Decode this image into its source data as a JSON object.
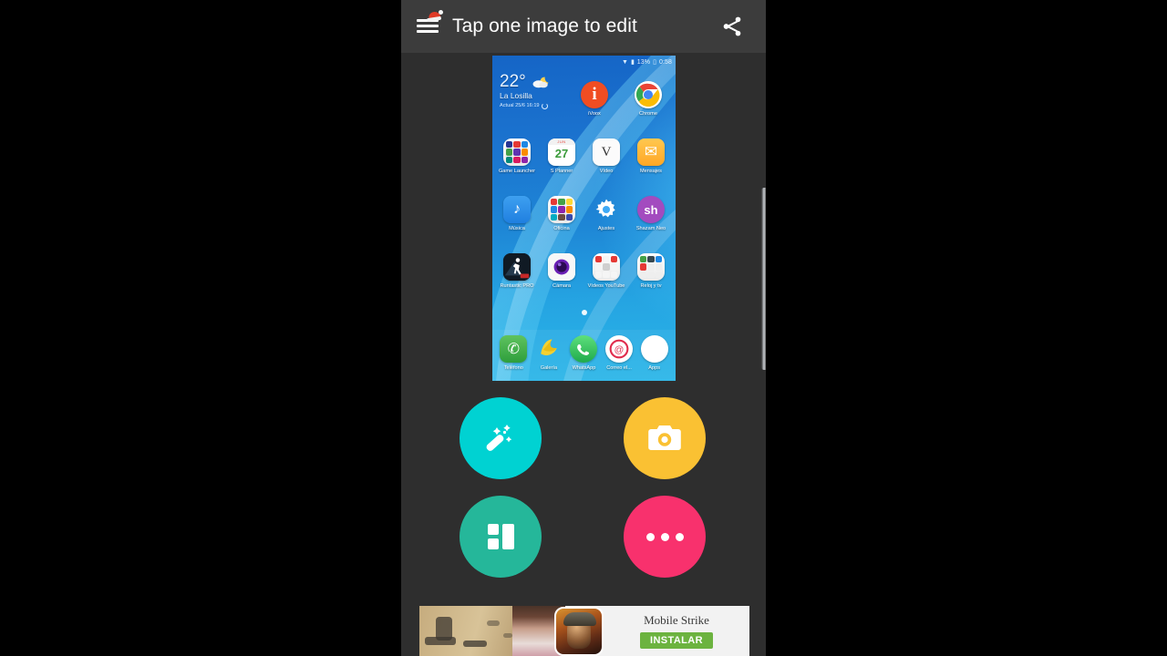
{
  "appbar": {
    "title": "Tap one image to edit",
    "menu_icon": "hamburger-menu-icon-with-santa-hat",
    "share_icon": "share-icon"
  },
  "screenshot": {
    "status_bar": {
      "wifi_icon": "wifi-icon",
      "signal_icon": "signal-icon",
      "battery_percent": "13%",
      "battery_icon": "battery-icon",
      "time": "0:58"
    },
    "weather": {
      "temperature": "22°",
      "icon": "partly-cloudy-night-icon",
      "city": "La Losilla",
      "updated": "Actual 25/6 16:19"
    },
    "rows": [
      {
        "apps": [
          {
            "label": "iVoox",
            "icon": "ivoox-icon",
            "glyph": "i"
          },
          {
            "label": "Chrome",
            "icon": "chrome-icon",
            "glyph": ""
          }
        ]
      },
      {
        "apps": [
          {
            "label": "Game Launcher",
            "icon": "game-launcher-folder-icon",
            "glyph": ""
          },
          {
            "label": "S Planner",
            "icon": "s-planner-icon",
            "glyph": "27",
            "month": "JUN"
          },
          {
            "label": "Vídeo",
            "icon": "v-app-icon",
            "glyph": "V"
          },
          {
            "label": "Mensajes",
            "icon": "messages-icon",
            "glyph": "✉"
          }
        ]
      },
      {
        "apps": [
          {
            "label": "Música",
            "icon": "music-icon",
            "glyph": "♪"
          },
          {
            "label": "Oficina",
            "icon": "office-folder-icon",
            "glyph": ""
          },
          {
            "label": "Ajustes",
            "icon": "settings-gear-icon",
            "glyph": ""
          },
          {
            "label": "Shazam Neo",
            "icon": "shazam-icon",
            "glyph": "sh"
          }
        ]
      },
      {
        "apps": [
          {
            "label": "Runtastic PRO",
            "icon": "runtastic-icon",
            "glyph": ""
          },
          {
            "label": "Cámara",
            "icon": "camera-app-icon",
            "glyph": ""
          },
          {
            "label": "Vídeos YouTube",
            "icon": "youtube-folder-icon",
            "glyph": ""
          },
          {
            "label": "Reloj y tv",
            "icon": "clock-tv-folder-icon",
            "glyph": ""
          }
        ]
      }
    ],
    "dock": [
      {
        "label": "Teléfono",
        "icon": "phone-icon",
        "glyph": "✆"
      },
      {
        "label": "Galería",
        "icon": "gallery-icon",
        "glyph": ""
      },
      {
        "label": "WhatsApp",
        "icon": "whatsapp-icon",
        "glyph": ""
      },
      {
        "label": "Correo el...",
        "icon": "email-icon",
        "glyph": "@"
      },
      {
        "label": "Apps",
        "icon": "apps-drawer-icon",
        "glyph": ""
      }
    ],
    "page_indicator": "page-dot"
  },
  "actions": [
    {
      "name": "magic-edit",
      "icon": "magic-wand-icon",
      "color": "#00d2d2"
    },
    {
      "name": "camera",
      "icon": "camera-icon",
      "color": "#fac133"
    },
    {
      "name": "collage",
      "icon": "collage-grid-icon",
      "color": "#25b79a"
    },
    {
      "name": "more",
      "icon": "more-ellipsis-icon",
      "color": "#f8316d"
    }
  ],
  "ad": {
    "title": "Mobile Strike",
    "button_label": "INSTALAR",
    "icon": "mobile-strike-app-icon"
  },
  "colors": {
    "appbar_bg": "#3c3c3c",
    "body_bg": "#2e2e2e",
    "letterbox": "#000000",
    "install_green": "#6cb33f"
  }
}
